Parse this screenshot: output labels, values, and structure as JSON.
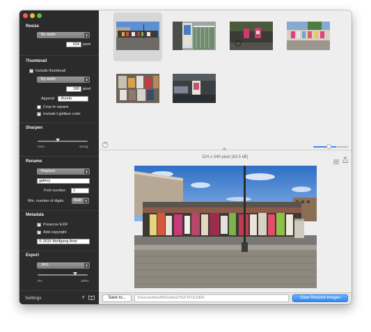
{
  "sidebar": {
    "resize": {
      "title": "Resize",
      "mode": "By width",
      "value": "524",
      "unit": "pixel"
    },
    "thumbnail": {
      "title": "Thumbnail",
      "include_label": "Include thumbnail",
      "include_checked": true,
      "mode": "By width",
      "value": "180",
      "unit": "pixel",
      "append_label": "Append",
      "append_value": "-thumb",
      "crop_label": "Crop to square",
      "crop_checked": false,
      "lightbox_label": "Include Lightbox code",
      "lightbox_checked": true
    },
    "sharpen": {
      "title": "Sharpen",
      "min_label": "none",
      "max_label": "strong",
      "level": 0.5
    },
    "rename": {
      "title": "Rename",
      "mode": "Replace",
      "name_value": "gallery",
      "first_number_label": "First number:",
      "first_number_value": "1",
      "min_digits_label": "Min. number of digits:",
      "min_digits_value": "Auto"
    },
    "metadata": {
      "title": "Metadata",
      "preserve_label": "Preserve EXIF",
      "preserve_checked": true,
      "copyright_label": "Add copyright",
      "copyright_checked": true,
      "copyright_value": "© 2015 Wolfgang Ante"
    },
    "export": {
      "title": "Export",
      "format": "JPG",
      "min_label": "0%",
      "max_label": "100%",
      "quality": 0.82
    },
    "footer": {
      "settings_label": "Settings",
      "add_icon": "plus-icon",
      "book_icon": "book-icon"
    }
  },
  "grid": {
    "help_label": "?",
    "zoom_level": 0.65
  },
  "preview": {
    "info": "524 x 349 pixel (83.5 kB)",
    "list_icon": "list-icon",
    "share_icon": "share-icon"
  },
  "bottom": {
    "save_to_label": "Save to...",
    "path_placeholder": "/Users/artissoft/Desktop/TESTFOLDER",
    "save_resized_label": "Save Resized Images"
  },
  "colors": {
    "sidebar_bg": "#2b2b2b",
    "accent": "#2f86f4",
    "close": "#fc5b57",
    "minimize": "#e5bf3c",
    "maximize": "#57c038"
  }
}
